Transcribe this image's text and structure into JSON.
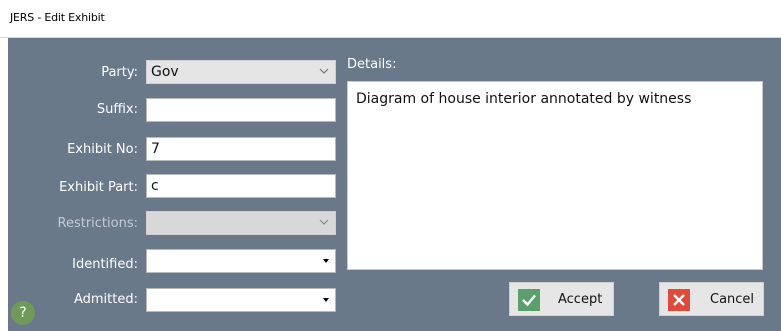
{
  "window": {
    "title": "JERS - Edit Exhibit"
  },
  "form": {
    "party": {
      "label": "Party:",
      "value": "Gov"
    },
    "suffix": {
      "label": "Suffix:",
      "value": ""
    },
    "exhibit_no": {
      "label": "Exhibit No:",
      "value": "7"
    },
    "exhibit_part": {
      "label": "Exhibit Part:",
      "value": "c"
    },
    "restrictions": {
      "label": "Restrictions:",
      "value": ""
    },
    "identified": {
      "label": "Identified:",
      "value": ""
    },
    "admitted": {
      "label": "Admitted:",
      "value": ""
    }
  },
  "details": {
    "label": "Details:",
    "value": "Diagram of house interior annotated by witness"
  },
  "buttons": {
    "accept": {
      "label": "Accept",
      "icon": "check-icon",
      "color": "#5aa06a"
    },
    "cancel": {
      "label": "Cancel",
      "icon": "close-icon",
      "color": "#e04a3a"
    }
  },
  "help": {
    "glyph": "?",
    "icon": "help-icon"
  },
  "colors": {
    "panel": "#697989",
    "label_text": "#ffffff",
    "dim_label": "#c3cbd3"
  }
}
